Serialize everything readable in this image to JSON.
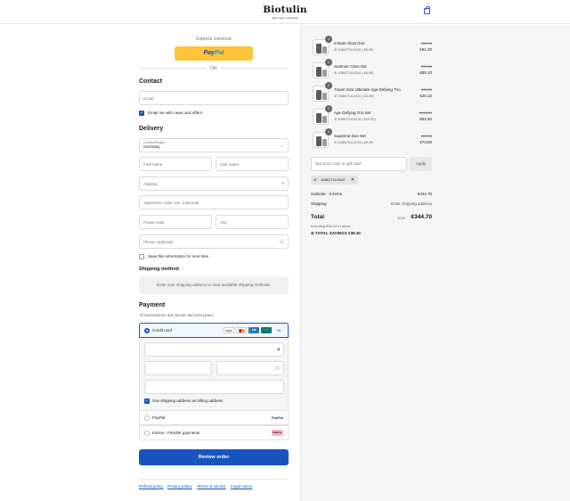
{
  "header": {
    "brand": "Biotulin",
    "tagline": "don't inject - just apply",
    "bag_icon": "shopping-bag-icon"
  },
  "express": {
    "label": "Express checkout",
    "paypal_pay": "Pay",
    "paypal_pal": "Pal",
    "or": "OR"
  },
  "contact": {
    "title": "Contact",
    "email_placeholder": "Email",
    "newsletter_label": "Email me with news and offers",
    "newsletter_checked": true
  },
  "delivery": {
    "title": "Delivery",
    "country_label": "Country/Region",
    "country_value": "Germany",
    "first_name": "First name",
    "last_name": "Last name",
    "address": "Address",
    "apartment": "Apartment, suite, etc. (optional)",
    "postal_code": "Postal code",
    "city": "City",
    "phone": "Phone (optional)",
    "save_info": "Save this information for next time"
  },
  "shipping": {
    "title": "Shipping method",
    "notice": "Enter your shipping address to view available shipping methods."
  },
  "payment": {
    "title": "Payment",
    "subtitle": "All transactions are secure and encrypted.",
    "credit_card": "Credit card",
    "more_brands": "+1",
    "billing_same": "Use shipping address as billing address",
    "paypal": "PayPal",
    "paypal_logo": "PayPal",
    "klarna": "Klarna - Flexible payments",
    "klarna_logo": "Klarna."
  },
  "actions": {
    "review_order": "Review order"
  },
  "footer": {
    "links": [
      "Refund policy",
      "Privacy policy",
      "Terms of service",
      "Legal notice"
    ]
  },
  "cart": {
    "items": [
      {
        "qty": "1",
        "name": "Instant Glow Duo",
        "code": "10BIOTULIN10 (-€6.00)",
        "old_price": "€66.00",
        "new_price": "€61.20"
      },
      {
        "qty": "1",
        "name": "Summer Glow Set",
        "code": "10BIOTULIN10 (-€9.90)",
        "old_price": "€99.00",
        "new_price": "€89.10"
      },
      {
        "qty": "1",
        "name": "Travel Size Ultimate Age-Defying Trio",
        "code": "10BIOTULIN10 (-€2.90)",
        "old_price": "€29.00",
        "new_price": "€26.10"
      },
      {
        "qty": "1",
        "name": "Age Defying Trio Set",
        "code": "10BIOTULIN10 (-€10.50)",
        "old_price": "€105.00",
        "new_price": "€94.50"
      },
      {
        "qty": "1",
        "name": "Supreme Duo Set",
        "code": "10BIOTULIN10 (-€8.20)",
        "old_price": "€82.00",
        "new_price": "€73.80"
      }
    ],
    "discount_placeholder": "Discount code or gift card",
    "apply": "Apply",
    "applied_code": "10BIOTULIN10",
    "subtotal_label": "Subtotal · 5 items",
    "subtotal_value": "€344.70",
    "shipping_label": "Shipping",
    "shipping_value": "Enter shipping address",
    "total_label": "Total",
    "currency": "EUR",
    "total_value": "€344.70",
    "taxes_note": "Including €55.04 in taxes",
    "savings_label": "TOTAL SAVINGS",
    "savings_value": "€38.30"
  }
}
